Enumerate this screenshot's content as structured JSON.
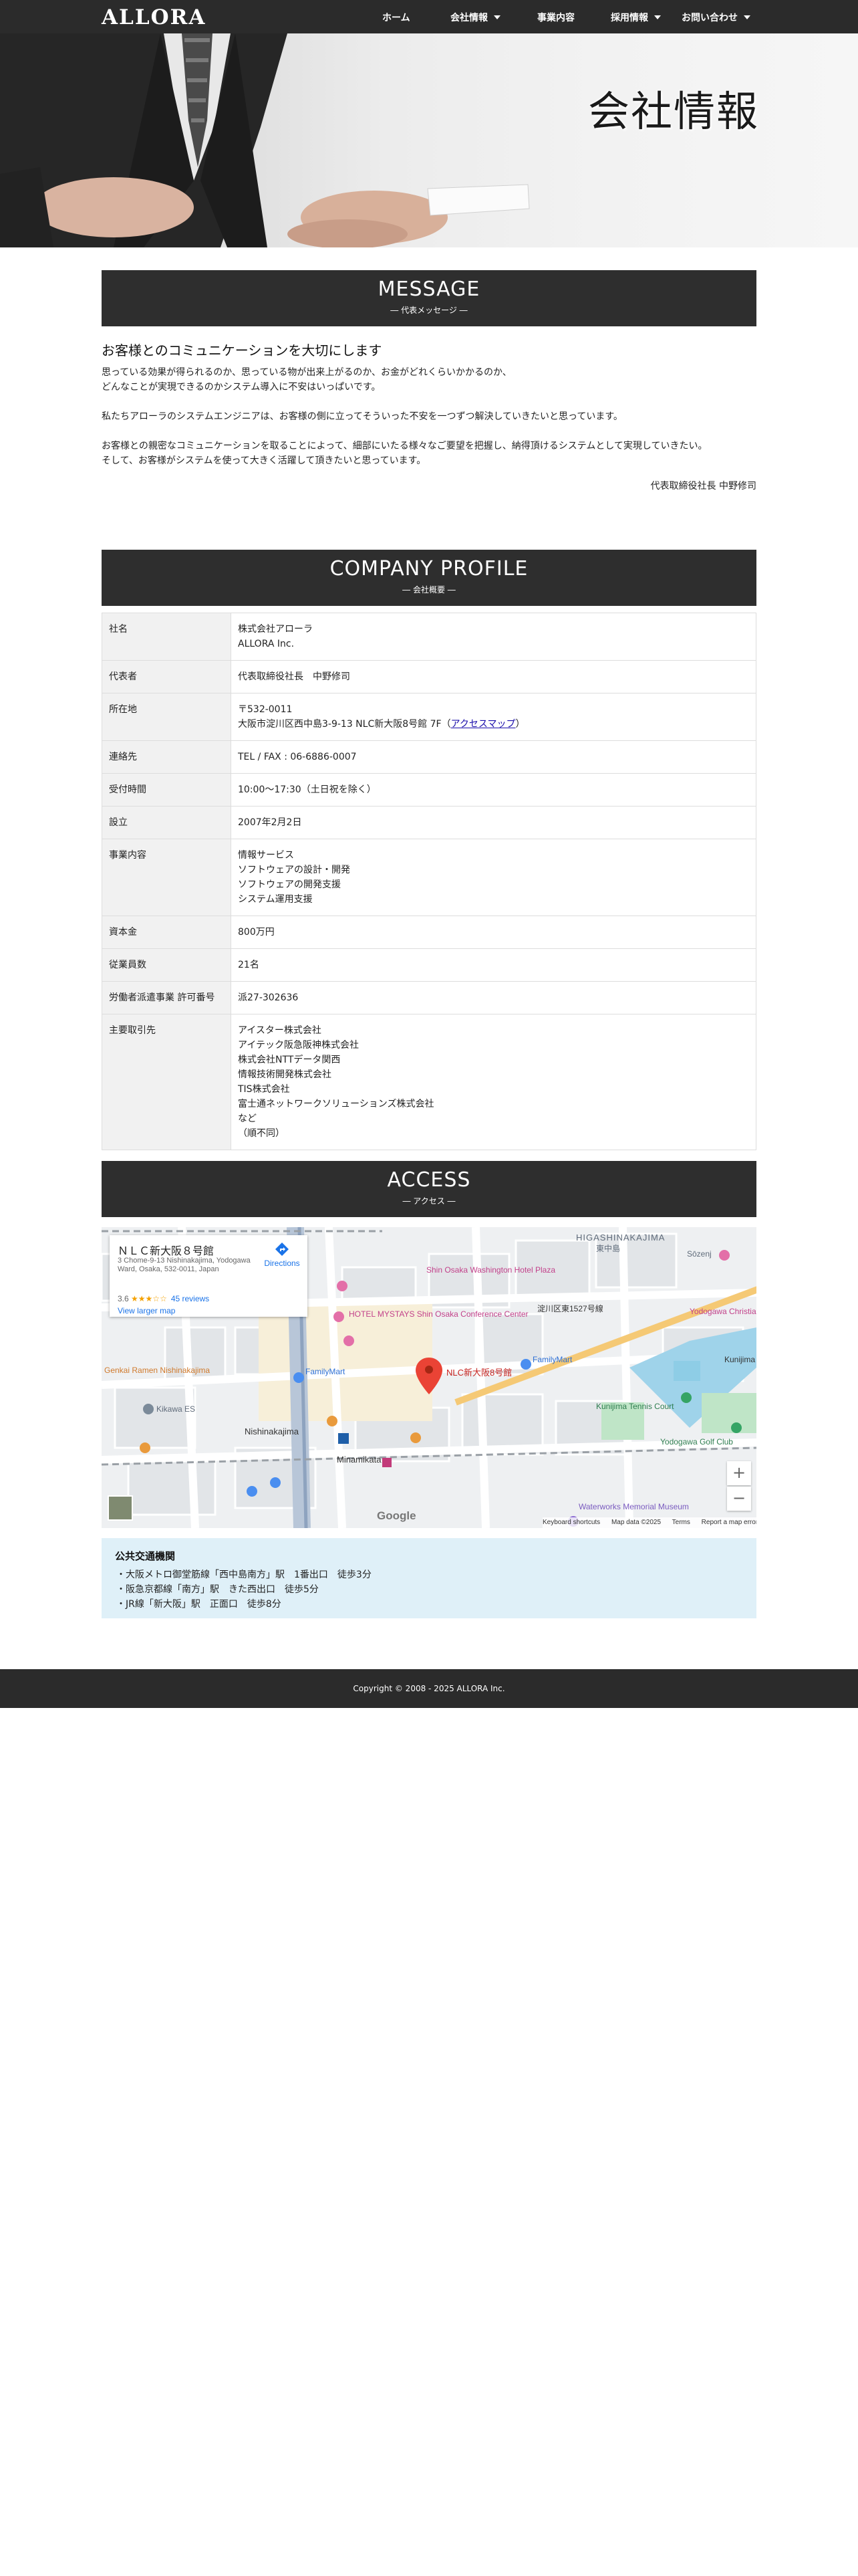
{
  "nav": {
    "logo": "ALLORA",
    "items": [
      {
        "label": "ホーム",
        "dropdown": false
      },
      {
        "label": "会社情報",
        "dropdown": true
      },
      {
        "label": "事業内容",
        "dropdown": false
      },
      {
        "label": "採用情報",
        "dropdown": true
      },
      {
        "label": "お問い合わせ",
        "dropdown": true
      }
    ]
  },
  "hero": {
    "title": "会社情報"
  },
  "message": {
    "title": "MESSAGE",
    "subtitle": "―  代表メッセージ  ―",
    "heading": "お客様とのコミュニケーションを大切にします",
    "p1": [
      "思っている効果が得られるのか、思っている物が出来上がるのか、お金がどれくらいかかるのか、",
      "どんなことが実現できるのかシステム導入に不安はいっぱいです。"
    ],
    "p2": [
      "私たちアローラのシステムエンジニアは、お客様の側に立ってそういった不安を一つずつ解決していきたいと思っています。"
    ],
    "p3": [
      "お客様との親密なコミュニケーションを取ることによって、細部にいたる様々なご要望を把握し、納得頂けるシステムとして実現していきたい。",
      "そして、お客様がシステムを使って大きく活躍して頂きたいと思っています。"
    ],
    "signature": "代表取締役社長 中野修司"
  },
  "profile": {
    "title": "COMPANY PROFILE",
    "subtitle": "―  会社概要  ―",
    "rows": [
      {
        "label": "社名",
        "lines": [
          "株式会社アローラ",
          "ALLORA Inc."
        ]
      },
      {
        "label": "代表者",
        "lines": [
          "代表取締役社長　中野修司"
        ]
      },
      {
        "label": "所在地",
        "lines": [
          "〒532-0011",
          "大阪市淀川区西中島3-9-13 NLC新大阪8号館 7F"
        ],
        "link": "アクセスマップ"
      },
      {
        "label": "連絡先",
        "lines": [
          "TEL / FAX : 06-6886-0007"
        ]
      },
      {
        "label": "受付時間",
        "lines": [
          "10:00〜17:30（土日祝を除く）"
        ]
      },
      {
        "label": "設立",
        "lines": [
          "2007年2月2日"
        ]
      },
      {
        "label": "事業内容",
        "lines": [
          "情報サービス",
          "ソフトウェアの設計・開発",
          "ソフトウェアの開発支援",
          "システム運用支援"
        ]
      },
      {
        "label": "資本金",
        "lines": [
          "800万円"
        ]
      },
      {
        "label": "従業員数",
        "lines": [
          "21名"
        ]
      },
      {
        "label": "労働者派遣事業 許可番号",
        "lines": [
          "派27-302636"
        ]
      },
      {
        "label": "主要取引先",
        "lines": [
          "アイスター株式会社",
          "アイテック阪急阪神株式会社",
          "株式会社NTTデータ関西",
          "情報技術開発株式会社",
          "TIS株式会社",
          "富士通ネットワークソリューションズ株式会社",
          "など",
          "（順不同）"
        ]
      }
    ]
  },
  "access": {
    "title": "ACCESS",
    "subtitle": "―  アクセス  ―",
    "map": {
      "place_name": "ＮＬＣ新大阪８号館",
      "address": "3 Chome-9-13 Nishinakajima, Yodogawa Ward, Osaka, 532-0011, Japan",
      "rating": "3.6",
      "stars": "★★★☆☆",
      "reviews": "45 reviews",
      "directions": "Directions",
      "larger_map": "View larger map",
      "marker_label": "NLC新大阪8号館",
      "zoom_in": "+",
      "zoom_out": "−",
      "google": "Google",
      "footer_items": [
        "Keyboard shortcuts",
        "Map data ©2025",
        "Terms",
        "Report a map error"
      ],
      "labels": {
        "higashi": "HIGASHINAKAJIMA",
        "higashi_jp": "東中島",
        "nishinakajima": "Nishinakajima",
        "minamikata": "Minamikata",
        "kunijima": "Kunijima",
        "kunijima_tennis": "Kunijima Tennis Court",
        "yodogawa_golf": "Yodogawa Golf Club",
        "waterworks": "Waterworks Memorial Museum",
        "washington": "Shin Osaka Washington Hotel Plaza",
        "mystays": "HOTEL MYSTAYS Shin Osaka Conference Center",
        "familymart": "FamilyMart",
        "kikawa": "Kikawa ES",
        "sozen": "Sōzenj",
        "yodogawa_christian": "Yodogawa Christian Hospital",
        "genkai": "Genkai Ramen Nishinakajima",
        "ward": "淀川区東1527号線"
      }
    },
    "transit": {
      "title": "公共交通機関",
      "lines": [
        "・大阪メトロ御堂筋線「西中島南方」駅　1番出口　徒歩3分",
        "・阪急京都線「南方」駅　きた西出口　徒歩5分",
        "・JR線「新大阪」駅　正面口　徒歩8分"
      ]
    }
  },
  "footer": {
    "copyright": "Copyright © 2008 - 2025 ALLORA Inc."
  }
}
